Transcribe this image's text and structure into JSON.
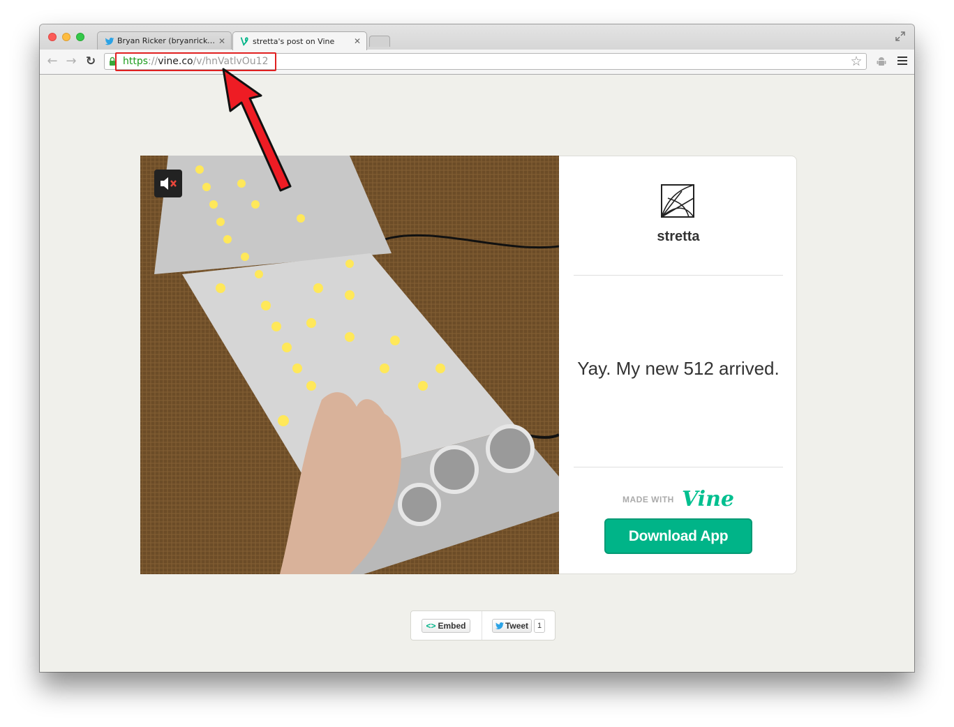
{
  "browser": {
    "tabs": [
      {
        "title": "Bryan Ricker (bryanricker)",
        "icon": "twitter-bird-icon",
        "active": false
      },
      {
        "title": "stretta's post on Vine",
        "icon": "vine-v-icon",
        "active": true
      }
    ],
    "url": {
      "protocol": "https",
      "separator": "://",
      "host": "vine.co",
      "path": "/v/hnVatlvOu12"
    }
  },
  "post": {
    "username": "stretta",
    "caption": "Yay. My new 512 arrived.",
    "media": {
      "type": "video",
      "muted": true
    }
  },
  "branding": {
    "made_with": "MADE WITH",
    "logo_text": "Vine",
    "download_label": "Download App",
    "accent_color": "#00b488"
  },
  "share": {
    "embed_label": "Embed",
    "tweet_label": "Tweet",
    "tweet_count": "1"
  },
  "annotation": {
    "color": "#e02020"
  }
}
